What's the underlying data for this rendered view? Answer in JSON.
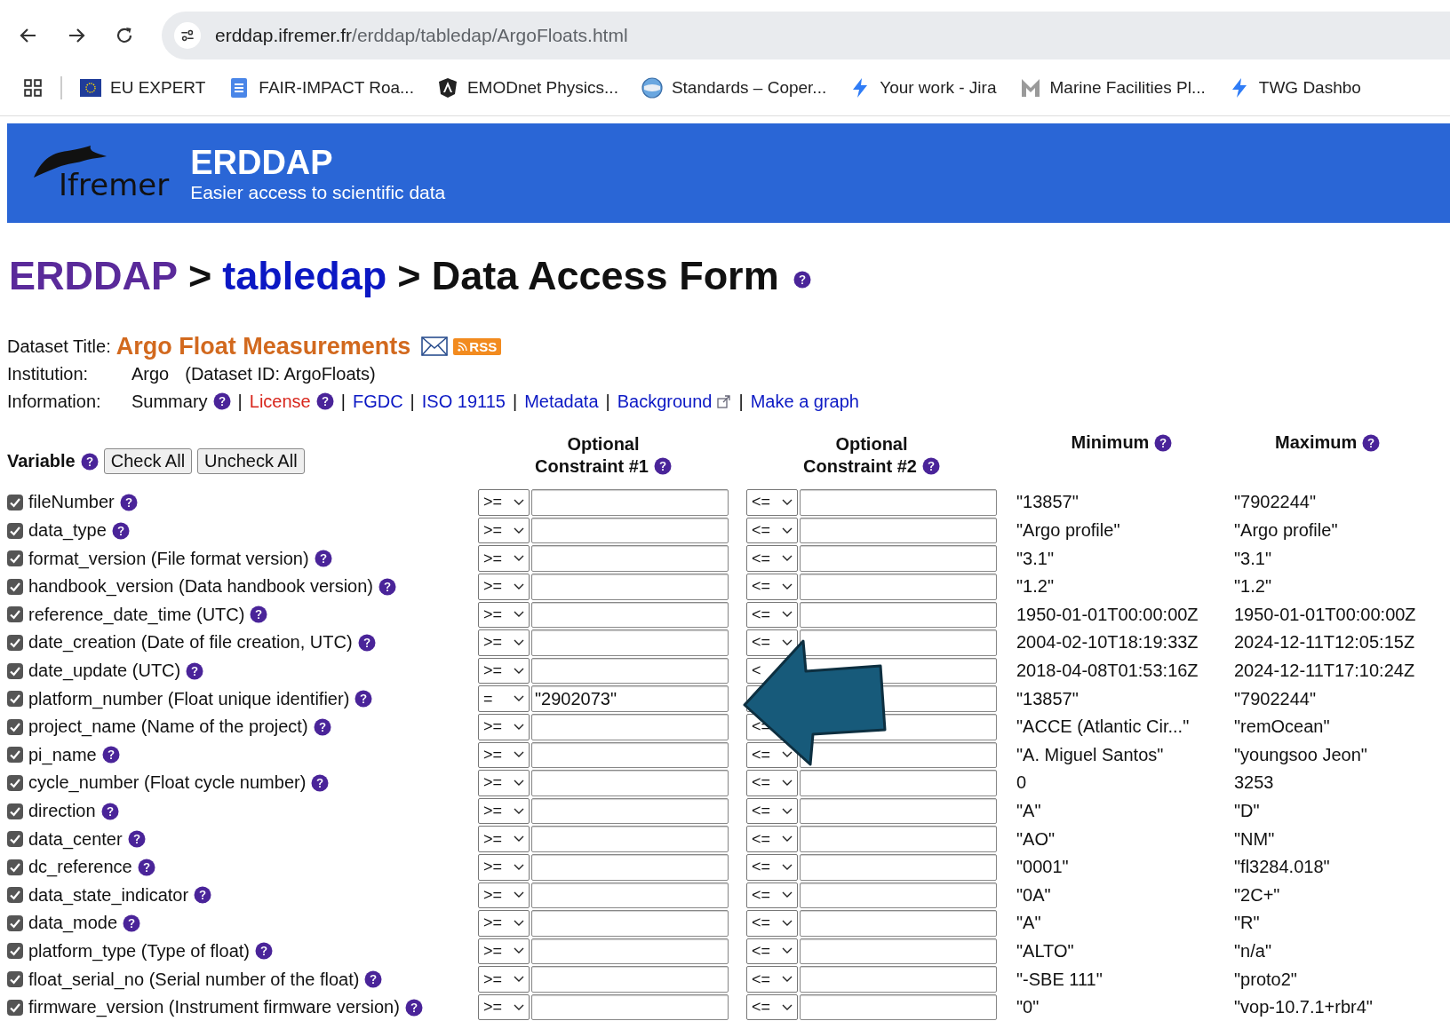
{
  "browser": {
    "url_host": "erddap.ifremer.fr",
    "url_path": "/erddap/tabledap/ArgoFloats.html",
    "bookmarks": [
      {
        "kind": "eu",
        "label": "EU EXPERT"
      },
      {
        "kind": "doc",
        "label": "FAIR-IMPACT Roa..."
      },
      {
        "kind": "shield",
        "label": "EMODnet Physics..."
      },
      {
        "kind": "globe",
        "label": "Standards – Coper..."
      },
      {
        "kind": "bolt",
        "label": "Your work - Jira"
      },
      {
        "kind": "m",
        "label": "Marine Facilities Pl..."
      },
      {
        "kind": "bolt",
        "label": "TWG Dashbo"
      }
    ]
  },
  "header": {
    "logo_text": "Ifremer",
    "title": "ERDDAP",
    "subtitle": "Easier access to scientific data"
  },
  "breadcrumb": [
    {
      "kind": "visited",
      "label": "ERDDAP"
    },
    {
      "kind": "link",
      "label": "tabledap"
    },
    {
      "kind": "current",
      "label": "Data Access Form"
    }
  ],
  "breadcrumb_separator": ">",
  "dataset": {
    "title_label": "Dataset Title:",
    "title": "Argo Float Measurements",
    "rss": "RSS",
    "institution_label": "Institution:",
    "institution": "Argo",
    "dataset_id": "(Dataset ID: ArgoFloats)",
    "information_label": "Information:",
    "separator": "|",
    "links": [
      {
        "kind": "plain",
        "label": "Summary",
        "help": true,
        "external": false
      },
      {
        "kind": "warning",
        "label": "License",
        "help": true,
        "external": false
      },
      {
        "kind": "link",
        "label": "FGDC",
        "help": false,
        "external": false
      },
      {
        "kind": "link",
        "label": "ISO 19115",
        "help": false,
        "external": false
      },
      {
        "kind": "link",
        "label": "Metadata",
        "help": false,
        "external": false
      },
      {
        "kind": "link",
        "label": "Background",
        "help": false,
        "external": true
      },
      {
        "kind": "link",
        "label": "Make a graph",
        "help": false,
        "external": false
      }
    ]
  },
  "form": {
    "variable_heading": "Variable",
    "check_all": "Check All",
    "uncheck_all": "Uncheck All",
    "constraint1_heading": [
      "Optional",
      "Constraint #1"
    ],
    "constraint2_heading": [
      "Optional",
      "Constraint #2"
    ],
    "minimum_heading": "Minimum",
    "maximum_heading": "Maximum",
    "rows": [
      {
        "name": "fileNumber",
        "checked": true,
        "op1": ">=",
        "op2": "<=",
        "min": "\"13857\"",
        "max": "\"7902244\""
      },
      {
        "name": "data_type",
        "checked": true,
        "op1": ">=",
        "op2": "<=",
        "min": "\"Argo profile\"",
        "max": "\"Argo profile\""
      },
      {
        "name": "format_version (File format version)",
        "checked": true,
        "op1": ">=",
        "op2": "<=",
        "min": "\"3.1\"",
        "max": "\"3.1\""
      },
      {
        "name": "handbook_version (Data handbook version)",
        "checked": true,
        "op1": ">=",
        "op2": "<=",
        "min": "\"1.2\"",
        "max": "\"1.2\""
      },
      {
        "name": "reference_date_time (UTC)",
        "checked": true,
        "op1": ">=",
        "op2": "<=",
        "min": "1950-01-01T00:00:00Z",
        "max": "1950-01-01T00:00:00Z"
      },
      {
        "name": "date_creation (Date of file creation, UTC)",
        "checked": true,
        "op1": ">=",
        "op2": "<=",
        "min": "2004-02-10T18:19:33Z",
        "max": "2024-12-11T12:05:15Z"
      },
      {
        "name": "date_update (UTC)",
        "checked": true,
        "op1": ">=",
        "op2": "<",
        "op2_chevron_hidden": true,
        "min": "2018-04-08T01:53:16Z",
        "max": "2024-12-11T17:10:24Z"
      },
      {
        "name": "platform_number (Float unique identifier)",
        "checked": true,
        "op1": "=",
        "value1": "\"2902073\"",
        "min": "\"13857\"",
        "max": "\"7902244\""
      },
      {
        "name": "project_name (Name of the project)",
        "checked": true,
        "op1": ">=",
        "op2": "<=",
        "op2_chevron_hidden": true,
        "min": "\"ACCE (Atlantic Cir...\"",
        "max": "\"remOcean\""
      },
      {
        "name": "pi_name",
        "checked": true,
        "op1": ">=",
        "op2": "<=",
        "min": "\"A. Miguel Santos\"",
        "max": "\"youngsoo Jeon\""
      },
      {
        "name": "cycle_number (Float cycle number)",
        "checked": true,
        "op1": ">=",
        "op2": "<=",
        "min": "0",
        "max": "3253"
      },
      {
        "name": "direction",
        "checked": true,
        "op1": ">=",
        "op2": "<=",
        "min": "\"A\"",
        "max": "\"D\""
      },
      {
        "name": "data_center",
        "checked": true,
        "op1": ">=",
        "op2": "<=",
        "min": "\"AO\"",
        "max": "\"NM\""
      },
      {
        "name": "dc_reference",
        "checked": true,
        "op1": ">=",
        "op2": "<=",
        "min": "\"0001\"",
        "max": "\"fl3284.018\""
      },
      {
        "name": "data_state_indicator",
        "checked": true,
        "op1": ">=",
        "op2": "<=",
        "min": "\"0A\"",
        "max": "\"2C+\""
      },
      {
        "name": "data_mode",
        "checked": true,
        "op1": ">=",
        "op2": "<=",
        "min": "\"A\"",
        "max": "\"R\""
      },
      {
        "name": "platform_type (Type of float)",
        "checked": true,
        "op1": ">=",
        "op2": "<=",
        "min": "\"ALTO\"",
        "max": "\"n/a\""
      },
      {
        "name": "float_serial_no (Serial number of the float)",
        "checked": true,
        "op1": ">=",
        "op2": "<=",
        "min": "\"-SBE 111\"",
        "max": "\"proto2\""
      },
      {
        "name": "firmware_version (Instrument firmware version)",
        "checked": true,
        "op1": ">=",
        "op2": "<=",
        "min": "\"0\"",
        "max": "\"vop-10.7.1+rbr4\""
      }
    ]
  }
}
